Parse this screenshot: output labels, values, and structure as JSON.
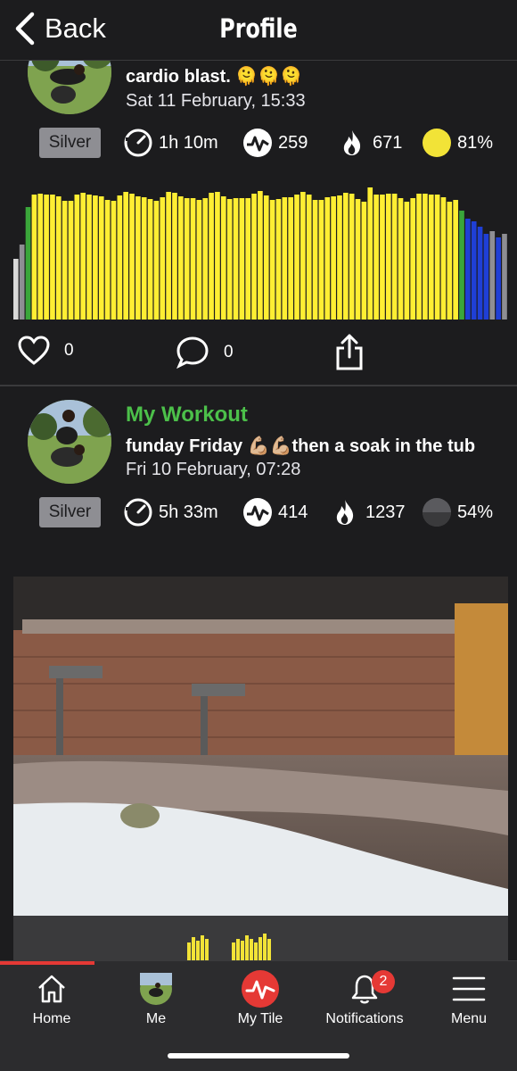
{
  "header": {
    "back_label": "Back",
    "title": "Profile"
  },
  "post1": {
    "caption": "cardio blast. 🫠🫠🫠",
    "date": "Sat 11 February, 15:33",
    "badge": "Silver",
    "duration": "1h 10m",
    "effort": "259",
    "calories": "671",
    "percent": "81%",
    "likes": "0",
    "comments": "0",
    "colors": {
      "yellow": "#ffee33",
      "green": "#3aa63a",
      "blue": "#1f3fd6",
      "grey": "#8e8e93"
    }
  },
  "post2": {
    "title": "My Workout",
    "caption": "funday Friday 💪🏼💪🏼then a soak in the tub",
    "date": "Fri 10 February, 07:28",
    "badge": "Silver",
    "duration": "5h 33m",
    "effort": "414",
    "calories": "1237",
    "percent": "54%"
  },
  "tabbar": {
    "items": [
      {
        "label": "Home",
        "icon": "home-icon"
      },
      {
        "label": "Me",
        "icon": "avatar-icon"
      },
      {
        "label": "My Tile",
        "icon": "heartbeat-icon"
      },
      {
        "label": "Notifications",
        "icon": "bell-icon"
      },
      {
        "label": "Menu",
        "icon": "menu-icon"
      }
    ],
    "notification_count": "2"
  },
  "accent": "#e53935",
  "title_green": "#4cc04a"
}
